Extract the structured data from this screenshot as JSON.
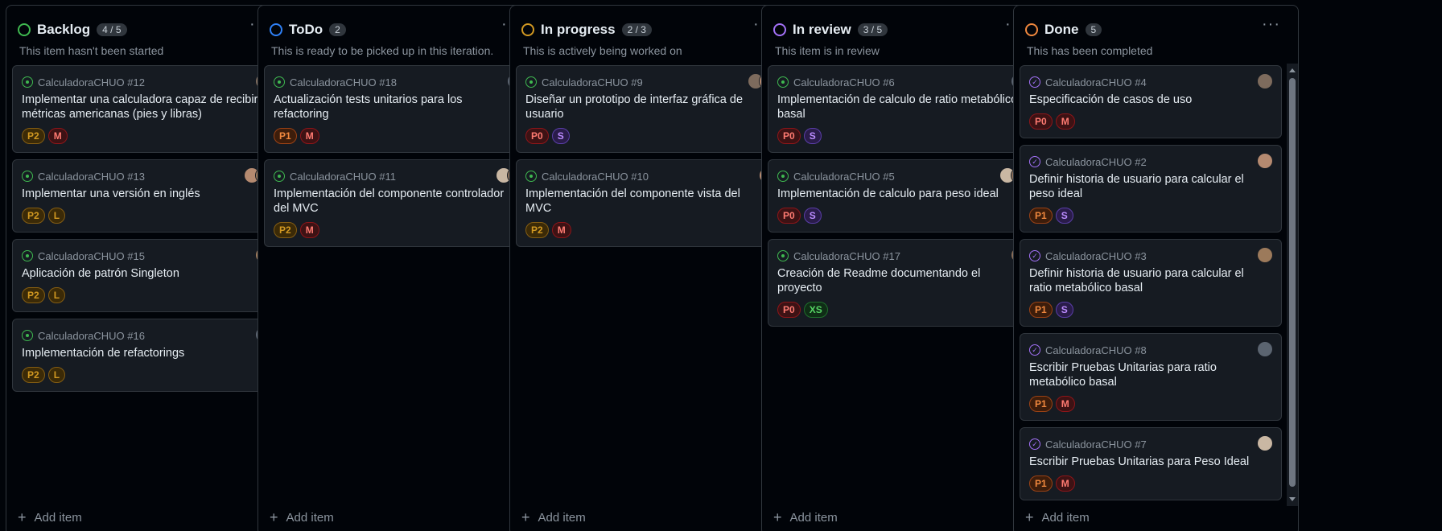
{
  "columns": [
    {
      "title": "Backlog",
      "count": "4 / 5",
      "color": "#3fb950",
      "description": "This item hasn't been started",
      "add_label": "Add item",
      "cards": [
        {
          "ref": "CalculadoraCHUO #12",
          "title": "Implementar una calculadora capaz de recibir métricas americanas (pies y libras)",
          "labels": [
            "P2",
            "M"
          ],
          "state": "open",
          "avatars": 1
        },
        {
          "ref": "CalculadoraCHUO #13",
          "title": "Implementar una versión en inglés",
          "labels": [
            "P2",
            "L"
          ],
          "state": "open",
          "avatars": 2
        },
        {
          "ref": "CalculadoraCHUO #15",
          "title": "Aplicación de patrón Singleton",
          "labels": [
            "P2",
            "L"
          ],
          "state": "open",
          "avatars": 1
        },
        {
          "ref": "CalculadoraCHUO #16",
          "title": "Implementación de refactorings",
          "labels": [
            "P2",
            "L"
          ],
          "state": "open",
          "avatars": 1
        }
      ]
    },
    {
      "title": "ToDo",
      "count": "2",
      "color": "#2f81f7",
      "description": "This is ready to be picked up in this iteration.",
      "add_label": "Add item",
      "cards": [
        {
          "ref": "CalculadoraCHUO #18",
          "title": "Actualización tests unitarios para los refactoring",
          "labels": [
            "P1",
            "M"
          ],
          "state": "open",
          "avatars": 1
        },
        {
          "ref": "CalculadoraCHUO #11",
          "title": "Implementación del componente controlador del MVC",
          "labels": [
            "P2",
            "M"
          ],
          "state": "open",
          "avatars": 2
        }
      ]
    },
    {
      "title": "In progress",
      "count": "2 / 3",
      "color": "#d29922",
      "description": "This is actively being worked on",
      "add_label": "Add item",
      "cards": [
        {
          "ref": "CalculadoraCHUO #9",
          "title": "Diseñar un prototipo de interfaz gráfica de usuario",
          "labels": [
            "P0",
            "S"
          ],
          "state": "open",
          "avatars": 2
        },
        {
          "ref": "CalculadoraCHUO #10",
          "title": "Implementación del componente vista del MVC",
          "labels": [
            "P2",
            "M"
          ],
          "state": "open",
          "avatars": 1
        }
      ]
    },
    {
      "title": "In review",
      "count": "3 / 5",
      "color": "#a371f7",
      "description": "This item is in review",
      "add_label": "Add item",
      "cards": [
        {
          "ref": "CalculadoraCHUO #6",
          "title": "Implementación de calculo de ratio metabólico basal",
          "labels": [
            "P0",
            "S"
          ],
          "state": "open",
          "avatars": 1
        },
        {
          "ref": "CalculadoraCHUO #5",
          "title": "Implementación de calculo para peso ideal",
          "labels": [
            "P0",
            "S"
          ],
          "state": "open",
          "avatars": 2
        },
        {
          "ref": "CalculadoraCHUO #17",
          "title": "Creación de Readme documentando el proyecto",
          "labels": [
            "P0",
            "XS"
          ],
          "state": "open",
          "avatars": 1
        }
      ]
    },
    {
      "title": "Done",
      "count": "5",
      "color": "#f0883e",
      "description": "This has been completed",
      "add_label": "Add item",
      "cards": [
        {
          "ref": "CalculadoraCHUO #4",
          "title": "Especificación de casos de uso",
          "labels": [
            "P0",
            "M"
          ],
          "state": "done",
          "avatars": 1
        },
        {
          "ref": "CalculadoraCHUO #2",
          "title": "Definir historia de usuario para calcular el peso ideal",
          "labels": [
            "P1",
            "S"
          ],
          "state": "done",
          "avatars": 1
        },
        {
          "ref": "CalculadoraCHUO #3",
          "title": "Definir historia de usuario para calcular el ratio metabólico basal",
          "labels": [
            "P1",
            "S"
          ],
          "state": "done",
          "avatars": 1
        },
        {
          "ref": "CalculadoraCHUO #8",
          "title": "Escribir Pruebas Unitarias para ratio metabólico basal",
          "labels": [
            "P1",
            "M"
          ],
          "state": "done",
          "avatars": 1
        },
        {
          "ref": "CalculadoraCHUO #7",
          "title": "Escribir Pruebas Unitarias para Peso Ideal",
          "labels": [
            "P1",
            "M"
          ],
          "state": "done",
          "avatars": 1
        }
      ]
    }
  ],
  "label_colors": {
    "P0": {
      "fg": "#ff7b72",
      "bg": "#3d1214",
      "border": "#8e1519"
    },
    "P1": {
      "fg": "#f0883e",
      "bg": "#3d1d0b",
      "border": "#9b4215"
    },
    "P2": {
      "fg": "#d29922",
      "bg": "#3b2a07",
      "border": "#845d13"
    },
    "M": {
      "fg": "#ff7b72",
      "bg": "#3d1214",
      "border": "#8e1519"
    },
    "L": {
      "fg": "#d29922",
      "bg": "#3b2a07",
      "border": "#845d13"
    },
    "S": {
      "fg": "#bc8cff",
      "bg": "#2a1c4a",
      "border": "#5a3ea8"
    },
    "XS": {
      "fg": "#56d364",
      "bg": "#0f2d16",
      "border": "#1f6f2c"
    }
  },
  "issue_open_color": "#3fb950",
  "issue_done_color": "#a371f7"
}
